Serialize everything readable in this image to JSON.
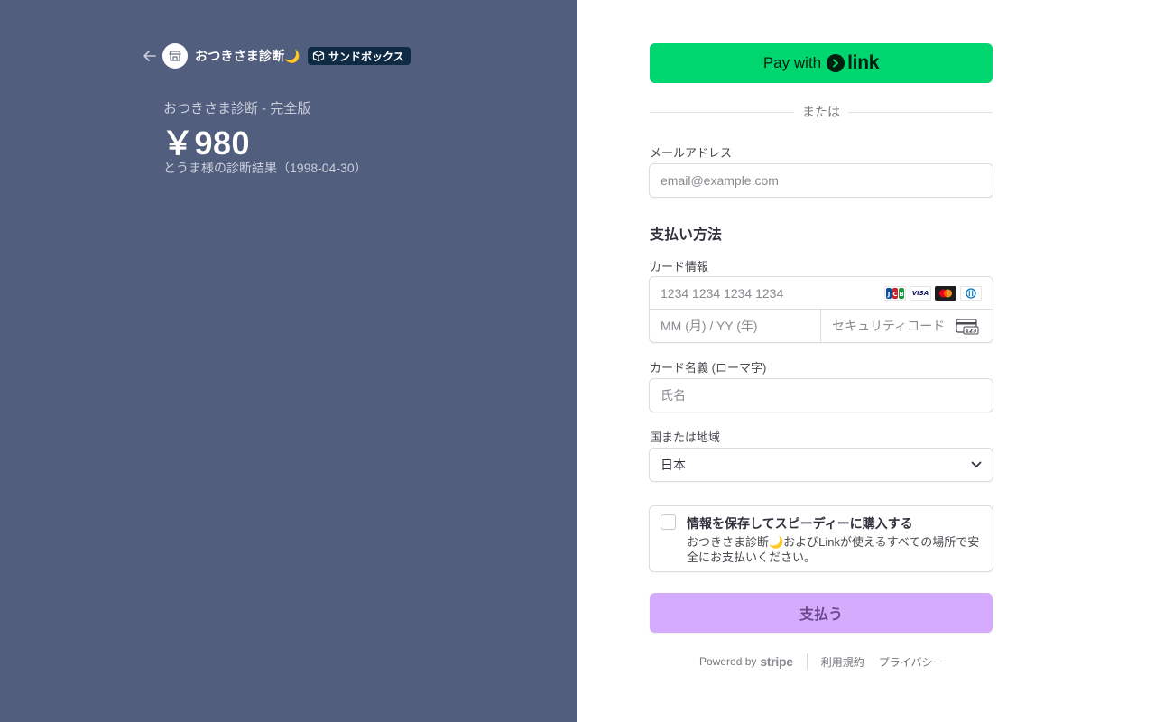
{
  "merchant": {
    "name": "おつきさま診断🌙",
    "sandbox_label": "サンドボックス"
  },
  "product": {
    "name": "おつきさま診断 - 完全版",
    "price": "￥980",
    "description": "とうま様の診断結果（1998-04-30）"
  },
  "link_button": {
    "pay_with": "Pay with",
    "link_word": "link"
  },
  "divider_text": "または",
  "email": {
    "label": "メールアドレス",
    "placeholder": "email@example.com",
    "value": ""
  },
  "payment_method_title": "支払い方法",
  "card": {
    "label": "カード情報",
    "number_placeholder": "1234 1234 1234 1234",
    "expiry_placeholder": "MM (月) / YY (年)",
    "cvc_placeholder": "セキュリティコード",
    "brands": [
      "jcb-icon",
      "visa-icon",
      "mastercard-icon",
      "diners-icon"
    ],
    "visa_text": "VISA"
  },
  "cardholder": {
    "label": "カード名義 (ローマ字)",
    "placeholder": "氏名"
  },
  "country": {
    "label": "国または地域",
    "value": "日本"
  },
  "save_info": {
    "title": "情報を保存してスピーディーに購入する",
    "description": "おつきさま診断🌙およびLinkが使えるすべての場所で安全にお支払いください。",
    "checked": false
  },
  "pay_button_label": "支払う",
  "footer": {
    "powered_by": "Powered by",
    "stripe": "stripe",
    "terms": "利用規約",
    "privacy": "プライバシー"
  },
  "colors": {
    "left_panel_bg": "#525e7e",
    "link_green": "#00d66f",
    "pay_button": "#d5acfd",
    "sandbox_badge": "#0f2b44"
  }
}
